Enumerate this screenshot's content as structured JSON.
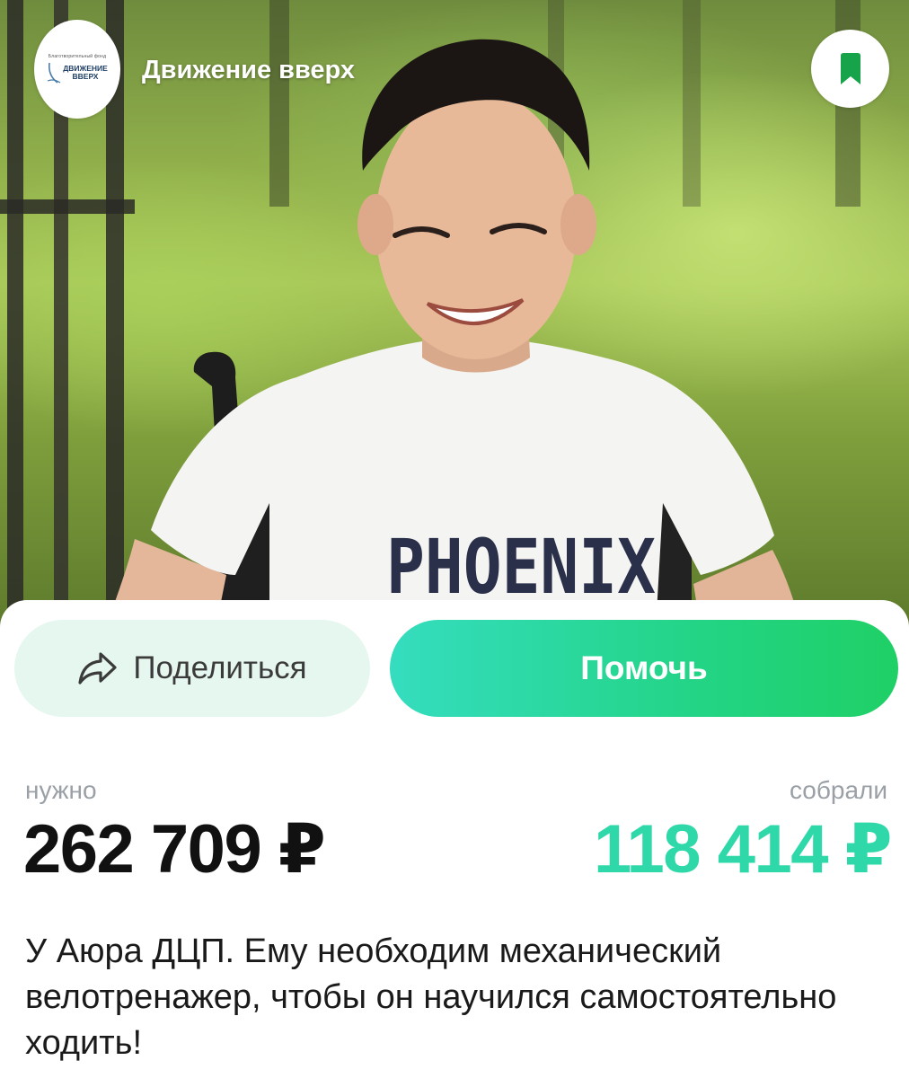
{
  "header": {
    "logo_small_text": "Благотворительный фонд",
    "logo_line1": "ДВИЖЕНИЕ",
    "logo_line2": "ВВЕРХ",
    "foundation_name": "Движение вверх",
    "bookmark_icon": "bookmark-icon"
  },
  "hero": {
    "shirt_print": "PHOENIX"
  },
  "actions": {
    "share_label": "Поделиться",
    "share_icon": "share-arrow-icon",
    "help_label": "Помочь"
  },
  "fundraising": {
    "needed_label": "нужно",
    "needed_value": "262 709 ₽",
    "collected_label": "собрали",
    "collected_value": "118 414 ₽"
  },
  "description": "У Аюра ДЦП. Ему необходим механический велотренажер, чтобы он научился самостоятельно ходить!",
  "colors": {
    "accent_green": "#23d486",
    "accent_teal": "#35ddbf",
    "collected_color": "#2fd8a8",
    "share_bg": "#e5f7ef",
    "bookmark_green": "#17a34a"
  }
}
